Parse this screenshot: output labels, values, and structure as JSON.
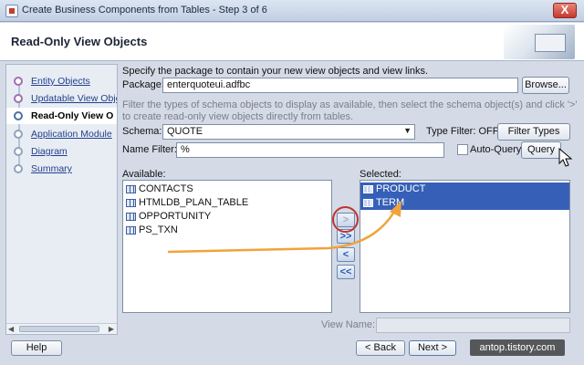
{
  "window": {
    "title": "Create Business Components from Tables - Step 3 of 6",
    "close_glyph": "X"
  },
  "header": {
    "title": "Read-Only View Objects"
  },
  "nav": {
    "items": [
      {
        "label": "Entity Objects"
      },
      {
        "label": "Updatable View Obje"
      },
      {
        "label": "Read-Only View O"
      },
      {
        "label": "Application Module"
      },
      {
        "label": "Diagram"
      },
      {
        "label": "Summary"
      }
    ],
    "current_index": 2
  },
  "package": {
    "instruction": "Specify the package to contain your new view objects and view links.",
    "label": "Package:",
    "value": "enterquoteui.adfbc",
    "browse_label": "Browse..."
  },
  "schema": {
    "instruction_line1": "Filter the types of schema objects to display as available, then select the schema object(s) and click '>'",
    "instruction_line2": "to create read-only view objects directly from tables.",
    "label": "Schema:",
    "value": "QUOTE",
    "type_filter_text": "Type Filter: OFF",
    "filter_types_label": "Filter Types"
  },
  "name_filter": {
    "label": "Name Filter:",
    "value": "%",
    "auto_query_label": "Auto-Query",
    "auto_query_checked": false,
    "query_label": "Query"
  },
  "available": {
    "label": "Available:",
    "items": [
      "CONTACTS",
      "HTMLDB_PLAN_TABLE",
      "OPPORTUNITY",
      "PS_TXN"
    ]
  },
  "selected": {
    "label": "Selected:",
    "items": [
      "PRODUCT",
      "TERM"
    ]
  },
  "shuttle": {
    "move": ">",
    "move_all": ">>",
    "remove": "<",
    "remove_all": "<<"
  },
  "view_name": {
    "label": "View Name:",
    "value": ""
  },
  "footer": {
    "help": "Help",
    "back": "< Back",
    "next": "Next >",
    "watermark": "antop.tistory.com"
  },
  "colors": {
    "selection": "#3660b8",
    "annotation_arrow": "#f0a33a",
    "annotation_circle": "#c1332f"
  }
}
